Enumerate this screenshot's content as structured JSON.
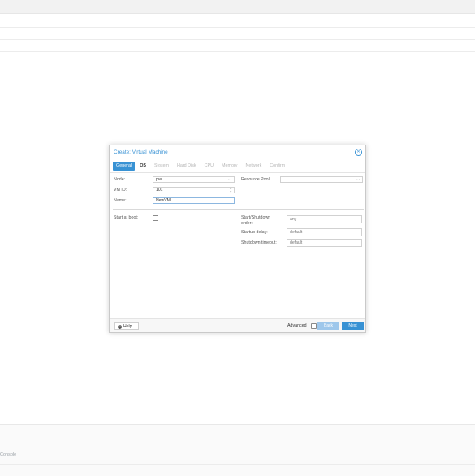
{
  "dialog": {
    "title": "Create: Virtual Machine",
    "close_icon": "close-circle-icon",
    "tabs": [
      {
        "label": "General",
        "state": "active"
      },
      {
        "label": "OS",
        "state": "bold"
      },
      {
        "label": "System",
        "state": "disabled"
      },
      {
        "label": "Hard Disk",
        "state": "disabled"
      },
      {
        "label": "CPU",
        "state": "disabled"
      },
      {
        "label": "Memory",
        "state": "disabled"
      },
      {
        "label": "Network",
        "state": "disabled"
      },
      {
        "label": "Confirm",
        "state": "disabled"
      }
    ],
    "form": {
      "node_label": "Node:",
      "node_value": "pve",
      "vmid_label": "VM ID:",
      "vmid_value": "101",
      "name_label": "Name:",
      "name_value": "NewVM",
      "resource_pool_label": "Resource Pool:",
      "resource_pool_value": "",
      "start_at_boot_label": "Start at boot:",
      "start_at_boot_checked": false,
      "start_shutdown_order_label": "Start/Shutdown order:",
      "start_shutdown_order_value": "any",
      "startup_delay_label": "Startup delay:",
      "startup_delay_value": "default",
      "shutdown_timeout_label": "Shutdown timeout:",
      "shutdown_timeout_value": "default"
    },
    "footer": {
      "help_label": "Help",
      "advanced_label": "Advanced",
      "advanced_checked": false,
      "back_label": "Back",
      "next_label": "Next"
    }
  },
  "background": {
    "console_label": "Console"
  },
  "colors": {
    "accent": "#3892d4",
    "accent_disabled": "#9ec7eb",
    "border": "#d1d1d1"
  }
}
